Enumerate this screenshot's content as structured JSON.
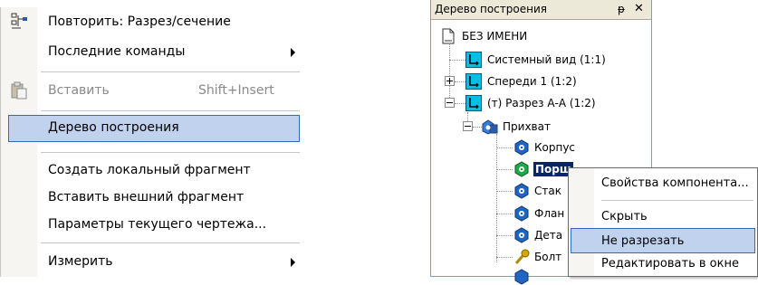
{
  "menu": {
    "items": [
      {
        "label": "Повторить: Разрез/сечение",
        "icon": "repeat-section-icon"
      },
      {
        "label": "Последние команды",
        "submenu": true
      },
      {
        "label": "Вставить",
        "shortcut": "Shift+Insert",
        "disabled": true,
        "icon": "paste-icon"
      },
      {
        "label": "Дерево построения",
        "highlighted": true
      },
      {
        "label": "Создать локальный фрагмент"
      },
      {
        "label": "Вставить внешний фрагмент"
      },
      {
        "label": "Параметры текущего чертежа..."
      },
      {
        "label": "Измерить",
        "submenu": true
      }
    ]
  },
  "panel": {
    "title": "Дерево построения",
    "pin": "ᵽ",
    "close": "✕",
    "tree": {
      "root": "БЕЗ ИМЕНИ",
      "views": [
        "Системный вид (1:1)",
        "Спереди 1 (1:2)",
        "(т) Разрез А-А (1:2)"
      ],
      "assembly": "Прихват",
      "parts": [
        "Корпус",
        "Порш",
        "Стак",
        "Флан",
        "Дета",
        "Болт"
      ]
    }
  },
  "context_menu": {
    "items": [
      "Свойства компонента...",
      "Скрыть",
      "Не разрезать",
      "Редактировать в окне"
    ]
  },
  "colors": {
    "highlight": "#c1d2ee",
    "highlight_border": "#316ac5",
    "selected": "#0a246a",
    "view_icon": "#00c0e8"
  }
}
